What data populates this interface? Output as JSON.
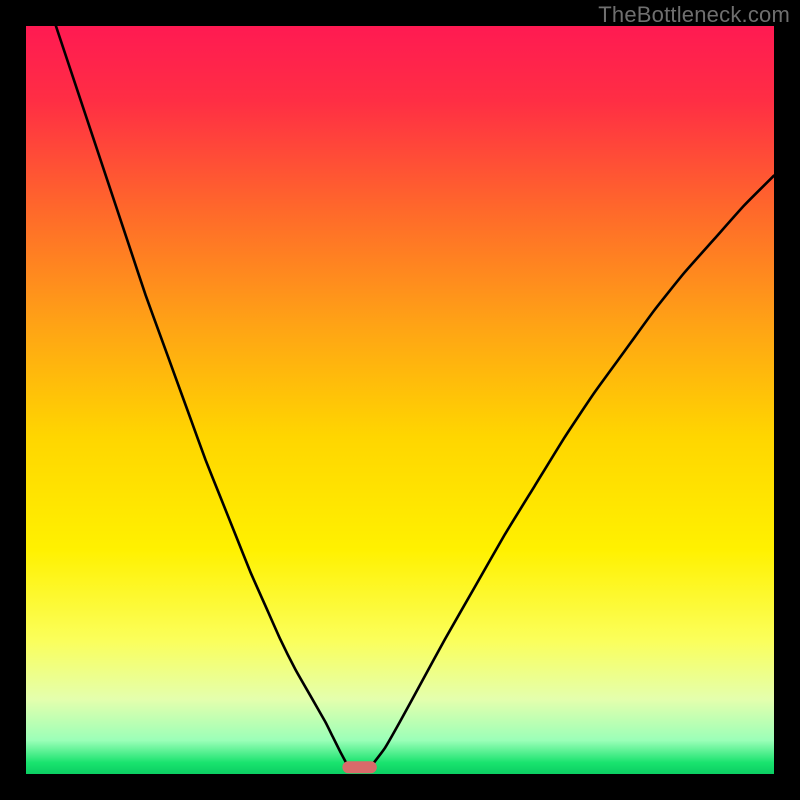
{
  "watermark": "TheBottleneck.com",
  "chart_data": {
    "type": "line",
    "title": "",
    "xlabel": "",
    "ylabel": "",
    "xlim": [
      0,
      100
    ],
    "ylim": [
      0,
      100
    ],
    "background_gradient": {
      "stops": [
        {
          "offset": 0.0,
          "color": "#ff1a52"
        },
        {
          "offset": 0.1,
          "color": "#ff2e44"
        },
        {
          "offset": 0.25,
          "color": "#ff6a2a"
        },
        {
          "offset": 0.4,
          "color": "#ffa315"
        },
        {
          "offset": 0.55,
          "color": "#ffd600"
        },
        {
          "offset": 0.7,
          "color": "#fff100"
        },
        {
          "offset": 0.82,
          "color": "#fbff5a"
        },
        {
          "offset": 0.9,
          "color": "#e4ffad"
        },
        {
          "offset": 0.955,
          "color": "#9bffb8"
        },
        {
          "offset": 0.985,
          "color": "#19e36e"
        },
        {
          "offset": 1.0,
          "color": "#0bce63"
        }
      ]
    },
    "series": [
      {
        "name": "left-branch",
        "x": [
          4,
          6,
          8,
          10,
          12,
          14,
          16,
          18,
          20,
          22,
          24,
          26,
          28,
          30,
          32,
          34,
          36,
          38,
          40,
          41,
          42,
          42.8
        ],
        "y": [
          100,
          94,
          88,
          82,
          76,
          70,
          64,
          58.5,
          53,
          47.5,
          42,
          37,
          32,
          27,
          22.5,
          18,
          14,
          10.5,
          7,
          5,
          3,
          1.5
        ]
      },
      {
        "name": "right-branch",
        "x": [
          46.5,
          48,
          50,
          53,
          56,
          60,
          64,
          68,
          72,
          76,
          80,
          84,
          88,
          92,
          96,
          100
        ],
        "y": [
          1.5,
          3.5,
          7,
          12.5,
          18,
          25,
          32,
          38.5,
          45,
          51,
          56.5,
          62,
          67,
          71.5,
          76,
          80
        ]
      }
    ],
    "marker": {
      "name": "min-marker",
      "x_center": 44.6,
      "y": 0.9,
      "width": 4.6,
      "height": 1.6,
      "color": "#d86a6a"
    }
  }
}
